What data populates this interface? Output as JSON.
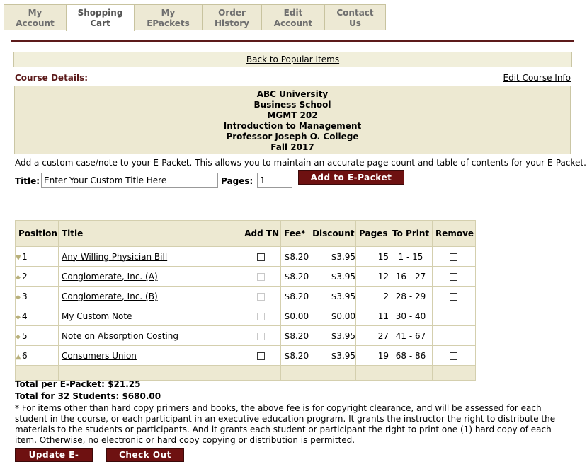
{
  "tabs": [
    {
      "line1": "My",
      "line2": "Account"
    },
    {
      "line1": "Shopping",
      "line2": "Cart"
    },
    {
      "line1": "My",
      "line2": "EPackets"
    },
    {
      "line1": "Order",
      "line2": "History"
    },
    {
      "line1": "Edit",
      "line2": "Account"
    },
    {
      "line1": "Contact",
      "line2": "Us"
    }
  ],
  "back_link": "Back to Popular Items",
  "course_details_label": "Course Details:",
  "edit_course_link": "Edit Course Info",
  "course": {
    "university": "ABC University",
    "school": "Business School",
    "code": "MGMT 202",
    "name": "Introduction to Management",
    "professor": "Professor Joseph O. College",
    "term": "Fall 2017"
  },
  "custom_note_text": "Add a custom case/note to your E-Packet. This allows you to maintain an accurate page count and table of contents for your E-Packet.",
  "form": {
    "title_label": "Title:",
    "title_value": "Enter Your Custom Title Here",
    "pages_label": "Pages:",
    "pages_value": "1",
    "add_button": "Add to E-Packet"
  },
  "table": {
    "headers": [
      "Position",
      "Title",
      "Add TN",
      "Fee*",
      "Discount",
      "Pages",
      "To Print",
      "Remove"
    ],
    "rows": [
      {
        "pos": "1",
        "arrow": "▼",
        "title": "Any Willing Physician Bill",
        "link": true,
        "tn_enabled": true,
        "fee": "$8.20",
        "discount": "$3.95",
        "pages": "15",
        "to_print": "1 - 15"
      },
      {
        "pos": "2",
        "arrow": "⬥",
        "title": "Conglomerate, Inc. (A)",
        "link": true,
        "tn_enabled": false,
        "fee": "$8.20",
        "discount": "$3.95",
        "pages": "12",
        "to_print": "16 - 27"
      },
      {
        "pos": "3",
        "arrow": "⬥",
        "title": "Conglomerate, Inc. (B)",
        "link": true,
        "tn_enabled": false,
        "fee": "$8.20",
        "discount": "$3.95",
        "pages": "2",
        "to_print": "28 - 29"
      },
      {
        "pos": "4",
        "arrow": "⬥",
        "title": "My Custom Note",
        "link": false,
        "tn_enabled": false,
        "fee": "$0.00",
        "discount": "$0.00",
        "pages": "11",
        "to_print": "30 - 40"
      },
      {
        "pos": "5",
        "arrow": "⬥",
        "title": "Note on Absorption Costing",
        "link": true,
        "tn_enabled": false,
        "fee": "$8.20",
        "discount": "$3.95",
        "pages": "27",
        "to_print": "41 - 67"
      },
      {
        "pos": "6",
        "arrow": "▲",
        "title": "Consumers Union",
        "link": true,
        "tn_enabled": true,
        "fee": "$8.20",
        "discount": "$3.95",
        "pages": "19",
        "to_print": "68 - 86"
      }
    ]
  },
  "totals": {
    "per_epacket": "Total per E-Packet: $21.25",
    "students": "Total for 32 Students: $680.00"
  },
  "footnote": "* For items other than hard copy primers and books, the above fee is for copyright clearance, and will be assessed for each student in the course, or each participant in an executive education program. It grants the instructor the right to distribute the materials to the students or participants. And it grants each student or participant the right to print one (1) hard copy of each item. Otherwise, no electronic or hard copy copying or distribution is permitted.",
  "buttons": {
    "update": "Update E-Packet",
    "checkout": "Check Out"
  }
}
